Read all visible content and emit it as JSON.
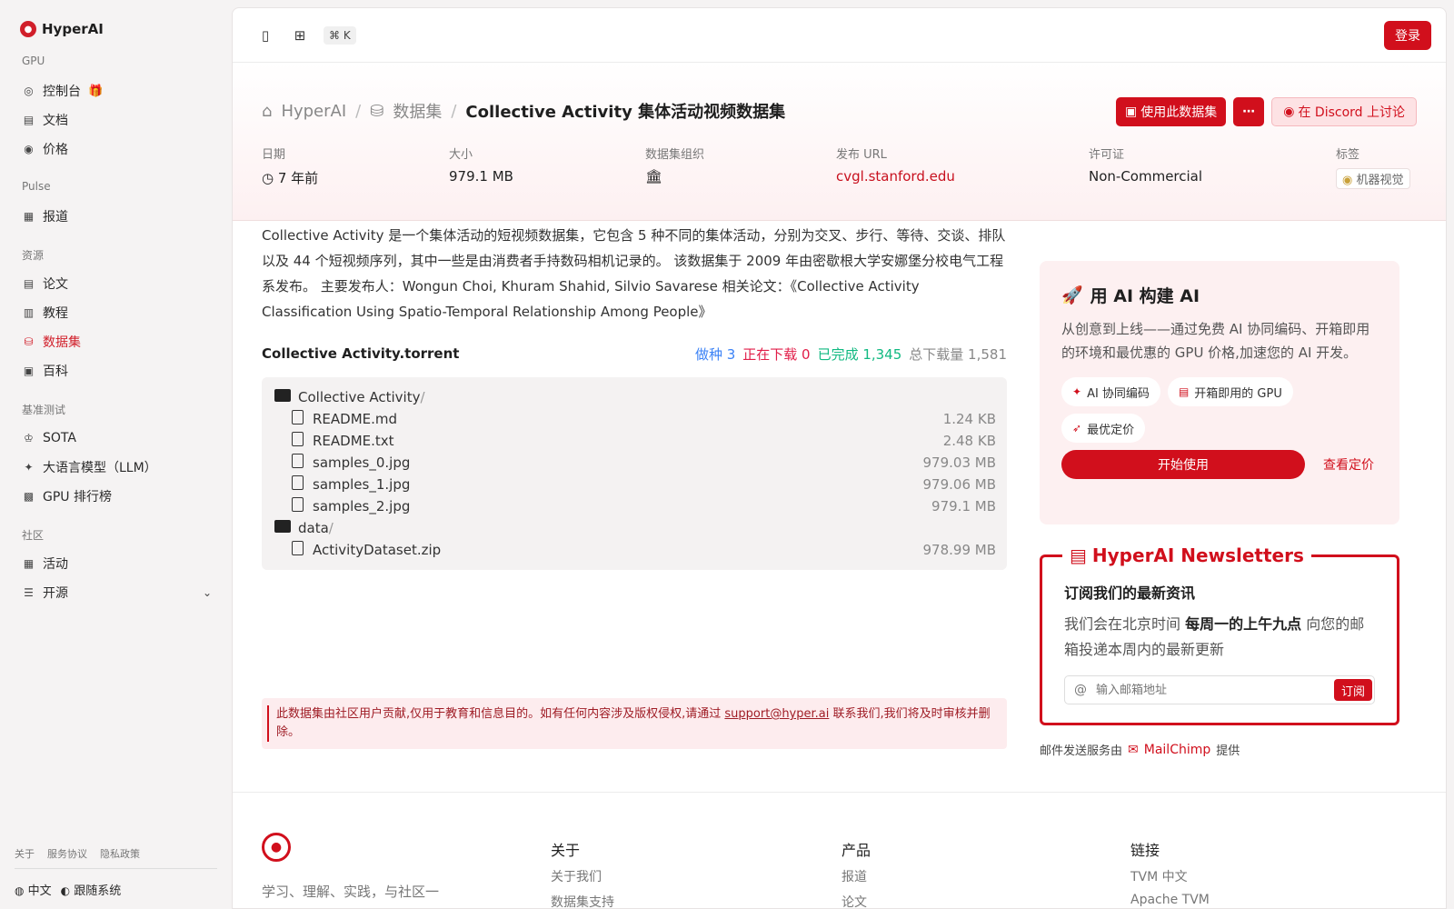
{
  "brand": "HyperAI",
  "sidebar": {
    "sections": [
      {
        "heading": "GPU",
        "items": [
          {
            "label": "控制台",
            "icon": "gauge-icon",
            "badge": "gift-icon"
          },
          {
            "label": "文档",
            "icon": "document-icon"
          },
          {
            "label": "价格",
            "icon": "price-icon"
          }
        ]
      },
      {
        "heading": "Pulse",
        "items": [
          {
            "label": "报道",
            "icon": "news-icon"
          }
        ]
      },
      {
        "heading": "资源",
        "items": [
          {
            "label": "论文",
            "icon": "paper-icon"
          },
          {
            "label": "教程",
            "icon": "book-icon"
          },
          {
            "label": "数据集",
            "icon": "database-icon",
            "active": true
          },
          {
            "label": "百科",
            "icon": "wiki-icon"
          }
        ]
      },
      {
        "heading": "基准测试",
        "items": [
          {
            "label": "SOTA",
            "icon": "trophy-icon"
          },
          {
            "label": "大语言模型（LLM）",
            "icon": "sparkle-icon"
          },
          {
            "label": "GPU 排行榜",
            "icon": "chip-icon"
          }
        ]
      },
      {
        "heading": "社区",
        "items": [
          {
            "label": "活动",
            "icon": "calendar-icon"
          },
          {
            "label": "开源",
            "icon": "list-icon",
            "expandable": true
          }
        ]
      }
    ],
    "footer_links": [
      "关于",
      "服务协议",
      "隐私政策"
    ],
    "language": "中文",
    "theme": "跟随系统"
  },
  "topbar": {
    "shortcut": "⌘ K",
    "login": "登录"
  },
  "breadcrumb": {
    "home": "HyperAI",
    "section": "数据集",
    "current": "Collective Activity 集体活动视频数据集"
  },
  "actions": {
    "use_dataset": "使用此数据集",
    "discord": "在 Discord 上讨论"
  },
  "meta": {
    "date_label": "日期",
    "date_value": "7 年前",
    "size_label": "大小",
    "size_value": "979.1 MB",
    "org_label": "数据集组织",
    "url_label": "发布 URL",
    "url_value": "cvgl.stanford.edu",
    "license_label": "许可证",
    "license_value": "Non-Commercial",
    "tags_label": "标签",
    "tag_value": "机器视觉"
  },
  "description": "Collective Activity 是一个集体活动的短视频数据集，它包含 5 种不同的集体活动，分别为交叉、步行、等待、交谈、排队以及 44 个短视频序列，其中一些是由消费者手持数码相机记录的。 该数据集于 2009 年由密歇根大学安娜堡分校电气工程系发布。 主要发布人：Wongun Choi, Khuram Shahid, Silvio Savarese 相关论文：《Collective Activity Classification Using Spatio-Temporal Relationship Among People》",
  "torrent": {
    "name": "Collective Activity.torrent",
    "seeding": "做种 3",
    "downloading": "正在下载 0",
    "completed": "已完成 1,345",
    "total": "总下载量 1,581",
    "files": [
      {
        "name": "Collective Activity",
        "type": "folder",
        "level": 0,
        "size": ""
      },
      {
        "name": "README.md",
        "type": "file",
        "level": 1,
        "size": "1.24 KB"
      },
      {
        "name": "README.txt",
        "type": "file",
        "level": 1,
        "size": "2.48 KB"
      },
      {
        "name": "samples_0.jpg",
        "type": "file",
        "level": 1,
        "size": "979.03 MB"
      },
      {
        "name": "samples_1.jpg",
        "type": "file",
        "level": 1,
        "size": "979.06 MB"
      },
      {
        "name": "samples_2.jpg",
        "type": "file",
        "level": 1,
        "size": "979.1 MB"
      },
      {
        "name": "data",
        "type": "folder",
        "level": 0,
        "size": ""
      },
      {
        "name": "ActivityDataset.zip",
        "type": "file",
        "level": 1,
        "size": "978.99 MB"
      }
    ]
  },
  "notice": {
    "before": "此数据集由社区用户贡献,仅用于教育和信息目的。如有任何内容涉及版权侵权,请通过 ",
    "email": "support@hyper.ai",
    "after": " 联系我们,我们将及时审核并删除。"
  },
  "promo": {
    "title": "用 AI 构建 AI",
    "desc": "从创意到上线——通过免费 AI 协同编码、开箱即用的环境和最优惠的 GPU 价格,加速您的 AI 开发。",
    "chips": [
      "AI 协同编码",
      "开箱即用的 GPU",
      "最优定价"
    ],
    "start": "开始使用",
    "pricing": "查看定价"
  },
  "newsletter": {
    "title": "HyperAI Newsletters",
    "heading": "订阅我们的最新资讯",
    "p_before": "我们会在北京时间 ",
    "p_bold": "每周一的上午九点",
    "p_after": " 向您的邮箱投递本周内的最新更新",
    "placeholder": "输入邮箱地址",
    "subscribe": "订阅",
    "provided_before": "邮件发送服务由",
    "provider": "MailChimp",
    "provided_after": "提供"
  },
  "footer": {
    "tagline": "学习、理解、实践，与社区一起构建人工智能的未来",
    "cols": [
      {
        "heading": "关于",
        "links": [
          "关于我们",
          "数据集支持"
        ]
      },
      {
        "heading": "产品",
        "links": [
          "报道",
          "论文"
        ]
      },
      {
        "heading": "链接",
        "links": [
          "TVM 中文",
          "Apache TVM"
        ]
      }
    ]
  },
  "colors": {
    "accent": "#d10f1c",
    "seed": "#3b82f6",
    "downloading": "#e11d48",
    "completed": "#10b981"
  }
}
